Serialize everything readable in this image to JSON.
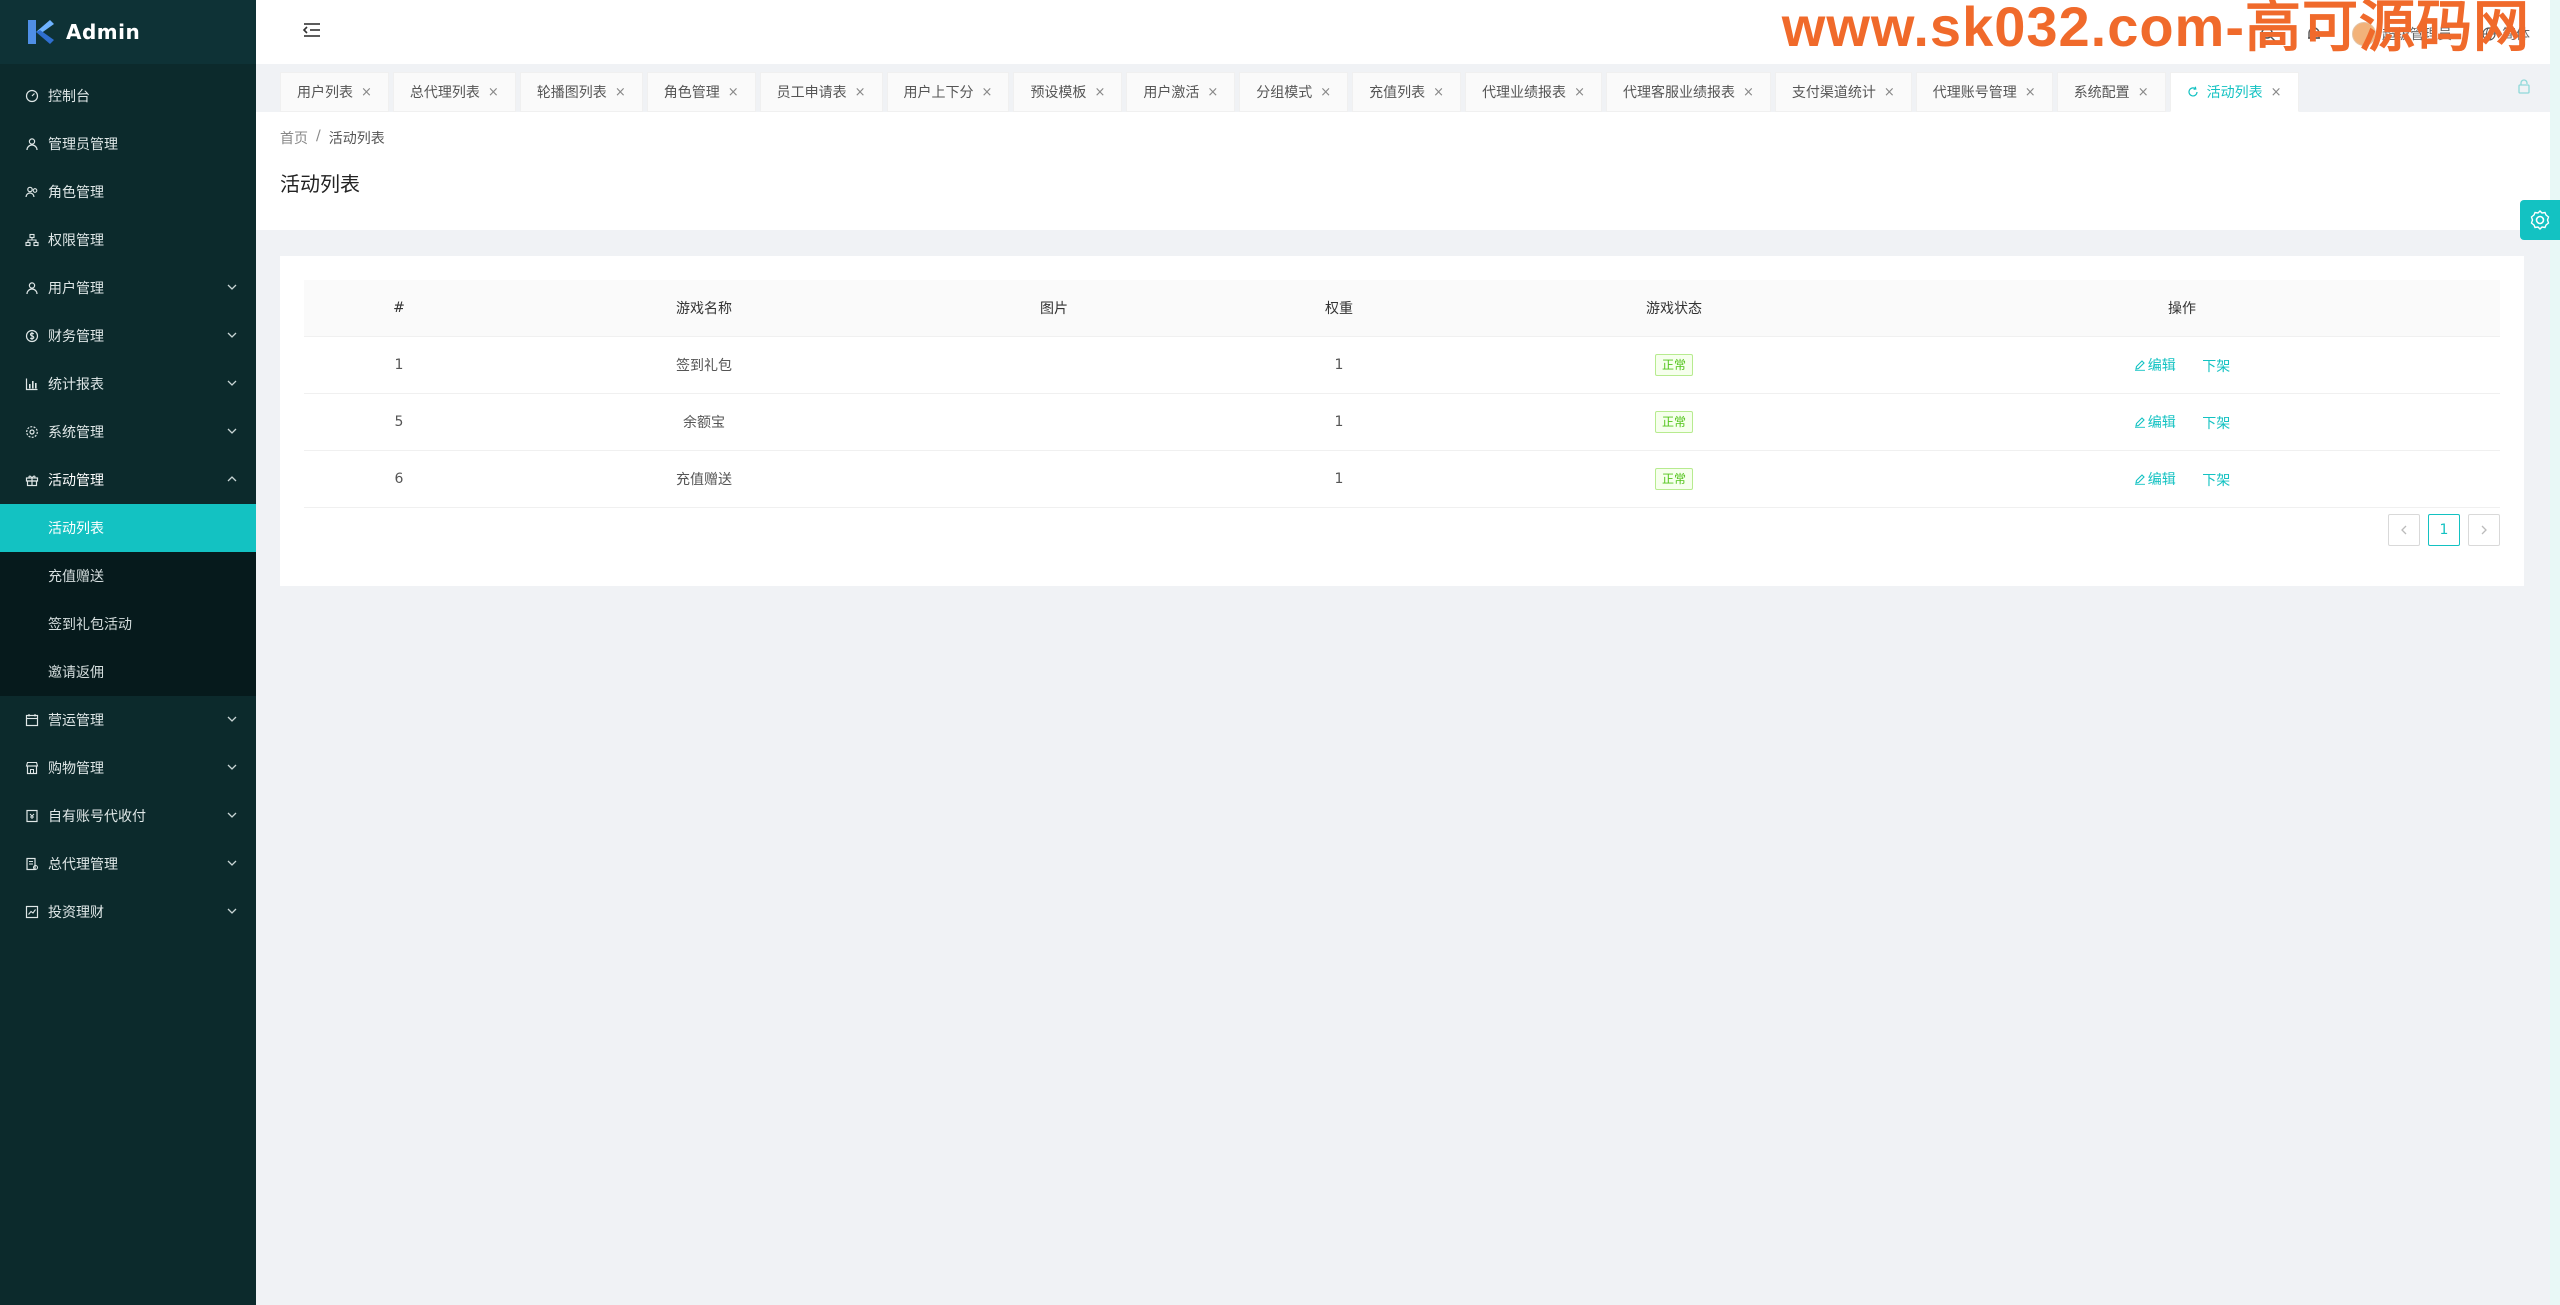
{
  "app": {
    "title": "Admin"
  },
  "watermark": "www.sk032.com-高可源码网",
  "header": {
    "user_name": "超级管理员",
    "language": "简体"
  },
  "sidebar": {
    "items": [
      {
        "label": "控制台",
        "icon": "dashboard-icon",
        "has_children": false
      },
      {
        "label": "管理员管理",
        "icon": "user-icon",
        "has_children": false
      },
      {
        "label": "角色管理",
        "icon": "team-icon",
        "has_children": false
      },
      {
        "label": "权限管理",
        "icon": "apartment-icon",
        "has_children": false
      },
      {
        "label": "用户管理",
        "icon": "user-icon",
        "has_children": true
      },
      {
        "label": "财务管理",
        "icon": "dollar-icon",
        "has_children": true
      },
      {
        "label": "统计报表",
        "icon": "bar-chart-icon",
        "has_children": true
      },
      {
        "label": "系统管理",
        "icon": "setting-icon",
        "has_children": true
      },
      {
        "label": "活动管理",
        "icon": "gift-icon",
        "has_children": true,
        "open": true,
        "children": [
          {
            "label": "活动列表",
            "active": true
          },
          {
            "label": "充值赠送"
          },
          {
            "label": "签到礼包活动"
          },
          {
            "label": "邀请返佣"
          }
        ]
      },
      {
        "label": "营运管理",
        "icon": "calendar-icon",
        "has_children": true
      },
      {
        "label": "购物管理",
        "icon": "shop-icon",
        "has_children": true
      },
      {
        "label": "自有账号代收付",
        "icon": "account-book-icon",
        "has_children": true
      },
      {
        "label": "总代理管理",
        "icon": "audit-icon",
        "has_children": true
      },
      {
        "label": "投资理财",
        "icon": "fund-icon",
        "has_children": true
      }
    ]
  },
  "tabs": [
    {
      "label": "用户列表"
    },
    {
      "label": "总代理列表"
    },
    {
      "label": "轮播图列表"
    },
    {
      "label": "角色管理"
    },
    {
      "label": "员工申请表"
    },
    {
      "label": "用户上下分"
    },
    {
      "label": "预设模板"
    },
    {
      "label": "用户激活"
    },
    {
      "label": "分组模式"
    },
    {
      "label": "充值列表"
    },
    {
      "label": "代理业绩报表"
    },
    {
      "label": "代理客服业绩报表"
    },
    {
      "label": "支付渠道统计"
    },
    {
      "label": "代理账号管理"
    },
    {
      "label": "系统配置"
    },
    {
      "label": "活动列表",
      "active": true
    }
  ],
  "breadcrumb": {
    "home": "首页",
    "separator": "/",
    "current": "活动列表"
  },
  "page": {
    "title": "活动列表"
  },
  "table": {
    "columns": [
      "#",
      "游戏名称",
      "图片",
      "权重",
      "游戏状态",
      "操作"
    ],
    "rows": [
      {
        "id": "1",
        "name": "签到礼包",
        "image": "",
        "weight": "1",
        "status": "正常",
        "edit": "编辑",
        "offline": "下架"
      },
      {
        "id": "5",
        "name": "余额宝",
        "image": "",
        "weight": "1",
        "status": "正常",
        "edit": "编辑",
        "offline": "下架"
      },
      {
        "id": "6",
        "name": "充值赠送",
        "image": "",
        "weight": "1",
        "status": "正常",
        "edit": "编辑",
        "offline": "下架"
      }
    ]
  },
  "pagination": {
    "current_page": "1"
  },
  "colors": {
    "accent": "#13c2c2",
    "sidebar_bg": "#0c2a2c",
    "submenu_bg": "#061a1c",
    "tag_success": "#52c41a",
    "watermark": "#f06a2b"
  }
}
